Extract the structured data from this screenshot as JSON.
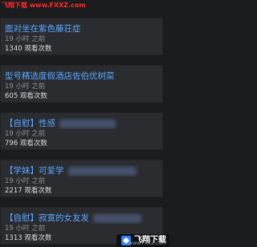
{
  "watermark": {
    "text": "飞翔下载 www.FXXZ.com"
  },
  "items": [
    {
      "title": "面对坐在紫色藤荘症",
      "time_ago": "19 小时 之前",
      "views": "1340 观看次数",
      "blurred": false
    },
    {
      "title": "型号精选度假酒店佐伯优树菜",
      "time_ago": "19 小时 之前",
      "views": "605 观看次数",
      "blurred": false
    },
    {
      "title": "【自慰】性感",
      "time_ago": "19 小时 之前",
      "views": "796 观看次数",
      "blurred": true
    },
    {
      "title": "【学妹】可爱学",
      "time_ago": "19 小时 之前",
      "views": "2217 观看次数",
      "blurred": true
    },
    {
      "title": "【自慰】寂寞的女友发",
      "time_ago": "19 小时 之前",
      "views": "1313 观看次数",
      "blurred": true
    }
  ],
  "badge": {
    "text": "飞翔下载",
    "sub": "www.FXXZ.com"
  },
  "colors": {
    "background": "#1b1c1e",
    "card": "#2a2c30",
    "title": "#5aa7ff",
    "meta": "#8b8f95",
    "views": "#d9dadc",
    "watermark": "#ff2a2a"
  }
}
